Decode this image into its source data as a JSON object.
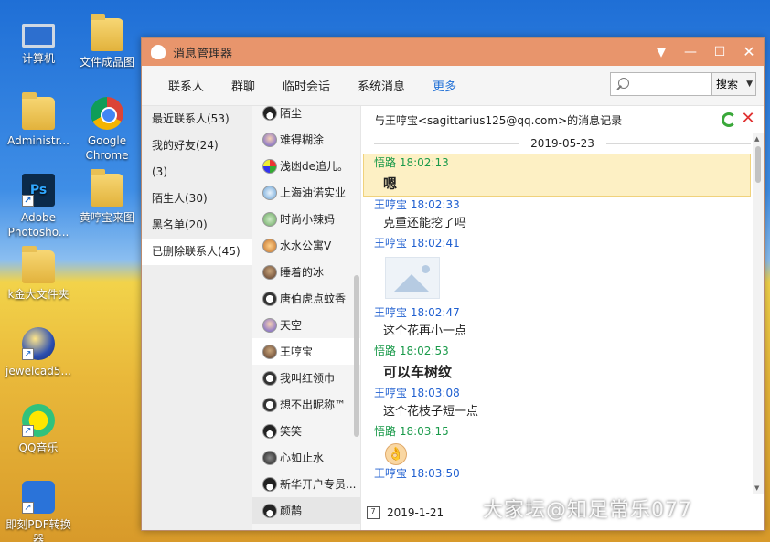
{
  "desktop": {
    "icons": [
      {
        "label": "计算机",
        "icon": "computer-icon"
      },
      {
        "label": "文件成品图",
        "icon": "folder-icon"
      },
      {
        "label": "Administr...",
        "icon": "user-folder-icon"
      },
      {
        "label": "Google Chrome",
        "icon": "chrome-icon"
      },
      {
        "label": "Adobe Photosho...",
        "icon": "photoshop-icon"
      },
      {
        "label": "黄哼宝来图",
        "icon": "folder-icon"
      },
      {
        "label": "k金大文件夹",
        "icon": "folder-icon"
      },
      {
        "label": "jewelcad5...",
        "icon": "jewelcad-icon"
      },
      {
        "label": "QQ音乐",
        "icon": "qq-music-icon"
      },
      {
        "label": "即刻PDF转换器",
        "icon": "pdf-converter-icon"
      }
    ]
  },
  "window": {
    "title": "消息管理器",
    "controls": {
      "dropdown": "▼",
      "minimize": "—",
      "maximize": "☐",
      "close": "✕"
    }
  },
  "menubar": {
    "items": [
      "联系人",
      "群聊",
      "临时会话",
      "系统消息",
      "更多"
    ],
    "search_placeholder": "",
    "search_button": "搜索"
  },
  "categories": [
    "最近联系人(53)",
    "我的好友(24)",
    "(3)",
    "陌生人(30)",
    "黑名单(20)",
    "已删除联系人(45)"
  ],
  "contacts": [
    "陌尘",
    "难得糊涂",
    "浅凼de追儿。",
    "上海油诺实业",
    "时尚小辣妈",
    "水水公寓V",
    "睡着的冰",
    "唐伯虎点蚊香",
    "天空",
    "王哼宝",
    "我叫红领巾",
    "想不出昵称™",
    "笑笑",
    "心如止水",
    "新华开户专员...",
    "颜鹊"
  ],
  "chat": {
    "header": "与王哼宝<sagittarius125@qq.com>的消息记录",
    "date_separator": "2019-05-23",
    "messages": [
      {
        "sender": "悟路",
        "time": "18:02:13",
        "text": "嗯"
      },
      {
        "sender": "王哼宝",
        "time": "18:02:33",
        "text": "克重还能挖了吗"
      },
      {
        "sender": "王哼宝",
        "time": "18:02:41",
        "text": ""
      },
      {
        "sender": "王哼宝",
        "time": "18:02:47",
        "text": "这个花再小一点"
      },
      {
        "sender": "悟路",
        "time": "18:02:53",
        "text": "可以车树纹"
      },
      {
        "sender": "王哼宝",
        "time": "18:03:08",
        "text": "这个花枝子短一点"
      },
      {
        "sender": "悟路",
        "time": "18:03:15",
        "text": ""
      },
      {
        "sender": "王哼宝",
        "time": "18:03:50",
        "text": ""
      }
    ],
    "date_filter": "2019-1-21"
  },
  "watermark": "大家坛@知足常乐077",
  "colors": {
    "titlebar": "#e8956c",
    "me": "#1a9a4a",
    "other": "#1f5fd0",
    "highlight": "#fdf0c4"
  }
}
